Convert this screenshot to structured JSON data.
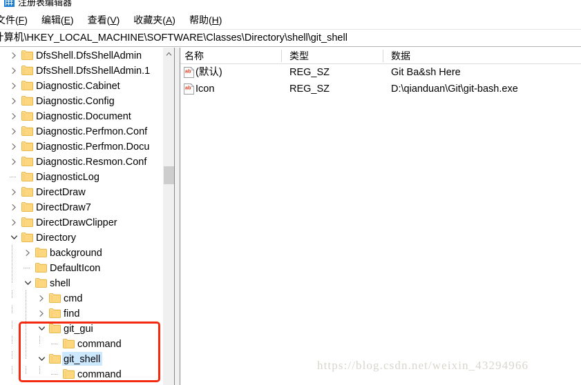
{
  "window": {
    "title": "注册表编辑器",
    "icon": "registry-editor-icon"
  },
  "menu": {
    "items": [
      {
        "label": "文件(F)",
        "text": "文件(",
        "accel": "F",
        "tail": ")"
      },
      {
        "label": "编辑(E)",
        "text": "编辑(",
        "accel": "E",
        "tail": ")"
      },
      {
        "label": "查看(V)",
        "text": "查看(",
        "accel": "V",
        "tail": ")"
      },
      {
        "label": "收藏夹(A)",
        "text": "收藏夹(",
        "accel": "A",
        "tail": ")"
      },
      {
        "label": "帮助(H)",
        "text": "帮助(",
        "accel": "H",
        "tail": ")"
      }
    ]
  },
  "address": {
    "value": "计算机\\HKEY_LOCAL_MACHINE\\SOFTWARE\\Classes\\Directory\\shell\\git_shell"
  },
  "tree": {
    "items": [
      {
        "label": "DfsShell.DfsShellAdmin",
        "depth": 0,
        "state": "collapsed",
        "selected": false
      },
      {
        "label": "DfsShell.DfsShellAdmin.1",
        "depth": 0,
        "state": "collapsed",
        "selected": false
      },
      {
        "label": "Diagnostic.Cabinet",
        "depth": 0,
        "state": "collapsed",
        "selected": false
      },
      {
        "label": "Diagnostic.Config",
        "depth": 0,
        "state": "collapsed",
        "selected": false
      },
      {
        "label": "Diagnostic.Document",
        "depth": 0,
        "state": "collapsed",
        "selected": false
      },
      {
        "label": "Diagnostic.Perfmon.Conf",
        "depth": 0,
        "state": "collapsed",
        "selected": false
      },
      {
        "label": "Diagnostic.Perfmon.Docu",
        "depth": 0,
        "state": "collapsed",
        "selected": false
      },
      {
        "label": "Diagnostic.Resmon.Conf",
        "depth": 0,
        "state": "collapsed",
        "selected": false
      },
      {
        "label": "DiagnosticLog",
        "depth": 0,
        "state": "leaf",
        "selected": false
      },
      {
        "label": "DirectDraw",
        "depth": 0,
        "state": "collapsed",
        "selected": false
      },
      {
        "label": "DirectDraw7",
        "depth": 0,
        "state": "collapsed",
        "selected": false
      },
      {
        "label": "DirectDrawClipper",
        "depth": 0,
        "state": "collapsed",
        "selected": false
      },
      {
        "label": "Directory",
        "depth": 0,
        "state": "expanded",
        "selected": false
      },
      {
        "label": "background",
        "depth": 1,
        "state": "collapsed",
        "selected": false
      },
      {
        "label": "DefaultIcon",
        "depth": 1,
        "state": "leaf",
        "selected": false
      },
      {
        "label": "shell",
        "depth": 1,
        "state": "expanded",
        "selected": false
      },
      {
        "label": "cmd",
        "depth": 2,
        "state": "collapsed",
        "selected": false
      },
      {
        "label": "find",
        "depth": 2,
        "state": "collapsed",
        "selected": false
      },
      {
        "label": "git_gui",
        "depth": 2,
        "state": "expanded",
        "selected": false
      },
      {
        "label": "command",
        "depth": 3,
        "state": "leaf",
        "selected": false
      },
      {
        "label": "git_shell",
        "depth": 2,
        "state": "expanded",
        "selected": true
      },
      {
        "label": "command",
        "depth": 3,
        "state": "leaf",
        "selected": false
      }
    ]
  },
  "list": {
    "columns": [
      {
        "label": "名称"
      },
      {
        "label": "类型"
      },
      {
        "label": "数据"
      }
    ],
    "rows": [
      {
        "name": "(默认)",
        "type": "REG_SZ",
        "data": "Git Ba&sh Here",
        "icon": "string-value-icon"
      },
      {
        "name": "Icon",
        "type": "REG_SZ",
        "data": "D:\\qianduan\\Git\\git-bash.exe",
        "icon": "string-value-icon"
      }
    ]
  },
  "annotation": {
    "highlight_color": "#f42a10"
  },
  "watermark": {
    "text": "https://blog.csdn.net/weixin_43294966"
  }
}
